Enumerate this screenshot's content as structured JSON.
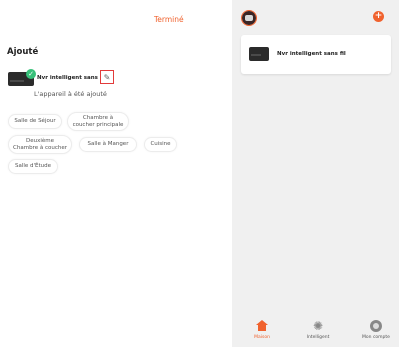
{
  "left": {
    "done_label": "Terminé",
    "section_title": "Ajouté",
    "device": {
      "name": "Nvr intelligent sans fil",
      "icon": "nvr-device-icon",
      "status_icon": "check-icon",
      "edit_icon": "pencil-icon"
    },
    "added_message": "L'appareil à été ajouté",
    "rooms": [
      "Salle de Séjour",
      "Chambre à coucher principale",
      "Deuxième Chambre à coucher",
      "Salle à Manger",
      "Cuisine",
      "Salle d'Étude"
    ]
  },
  "right": {
    "devices": [
      {
        "name": "Nvr intelligent sans fil"
      }
    ],
    "nav": {
      "items": [
        {
          "label": "Maison",
          "icon": "house-icon",
          "active": true
        },
        {
          "label": "Intelligent",
          "icon": "sun-icon",
          "active": false
        },
        {
          "label": "Mon compte",
          "icon": "profile-icon",
          "active": false
        }
      ]
    }
  },
  "colors": {
    "accent": "#f0622e",
    "success": "#37c079",
    "highlight_border": "#e23b3b"
  }
}
